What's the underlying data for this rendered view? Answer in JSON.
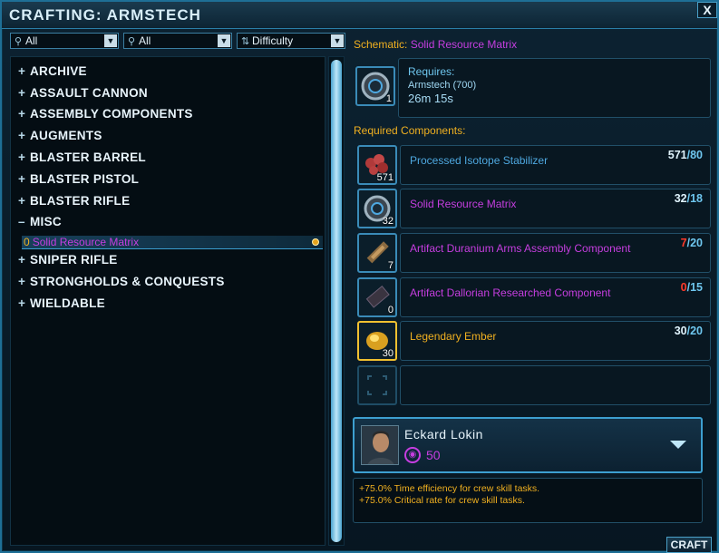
{
  "window": {
    "title": "CRAFTING: ARMSTECH",
    "close_label": "X"
  },
  "filters": [
    {
      "value": "All"
    },
    {
      "value": "All"
    },
    {
      "value": "Difficulty"
    }
  ],
  "tree": {
    "items": [
      {
        "sign": "+",
        "label": "ARCHIVE"
      },
      {
        "sign": "+",
        "label": "ASSAULT CANNON"
      },
      {
        "sign": "+",
        "label": "ASSEMBLY COMPONENTS"
      },
      {
        "sign": "+",
        "label": "AUGMENTS"
      },
      {
        "sign": "+",
        "label": "BLASTER BARREL"
      },
      {
        "sign": "+",
        "label": "BLASTER PISTOL"
      },
      {
        "sign": "+",
        "label": "BLASTER RIFLE"
      },
      {
        "sign": "–",
        "label": "MISC"
      },
      {
        "sign": "+",
        "label": "SNIPER RIFLE"
      },
      {
        "sign": "+",
        "label": "STRONGHOLDS & CONQUESTS"
      },
      {
        "sign": "+",
        "label": "WIELDABLE"
      }
    ],
    "selected_sub": {
      "count": "0",
      "label": "Solid Resource Matrix"
    }
  },
  "schematic": {
    "label": "Schematic:",
    "value": "Solid Resource Matrix",
    "slot_qty": "1",
    "requires_label": "Requires:",
    "requires_skill": "Armstech (700)",
    "time": "26m 15s"
  },
  "components_title": "Required Components:",
  "components": [
    {
      "name": "Processed Isotope Stabilizer",
      "qty": "571",
      "have": "571",
      "need": "/80",
      "name_color": "#4ea8e0",
      "have_color": "#dff2fb"
    },
    {
      "name": "Solid Resource Matrix",
      "qty": "32",
      "have": "32",
      "need": "/18",
      "name_color": "#c63ee0",
      "have_color": "#dff2fb"
    },
    {
      "name": "Artifact Duranium Arms Assembly Component",
      "qty": "7",
      "have": "7",
      "need": "/20",
      "name_color": "#c63ee0",
      "have_color": "#ff3a2a"
    },
    {
      "name": "Artifact Dallorian Researched Component",
      "qty": "0",
      "have": "0",
      "need": "/15",
      "name_color": "#c63ee0",
      "have_color": "#ff3a2a"
    },
    {
      "name": "Legendary Ember",
      "qty": "30",
      "have": "30",
      "need": "/20",
      "name_color": "#f0b020",
      "have_color": "#dff2fb"
    }
  ],
  "crew": {
    "name": "Eckard Lokin",
    "level": "50"
  },
  "bonuses": [
    "+75.0% Time efficiency for crew skill tasks.",
    "+75.0% Critical rate for crew skill tasks."
  ],
  "craft_label": "CRAFT"
}
